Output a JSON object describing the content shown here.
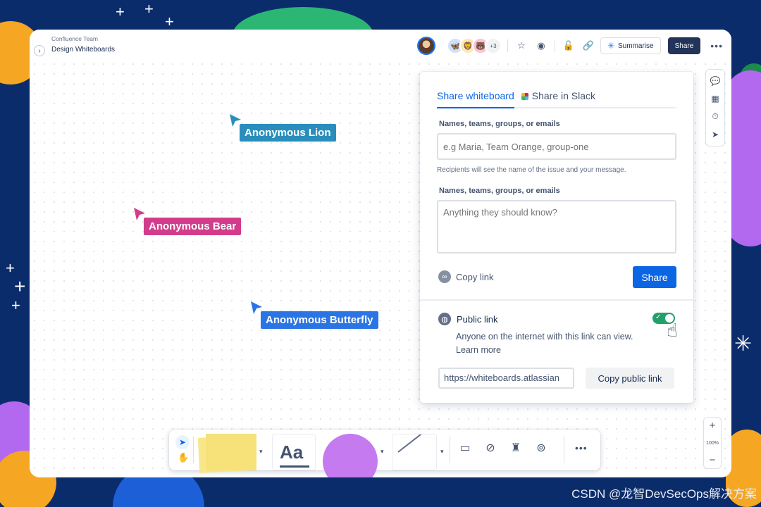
{
  "breadcrumb": {
    "space": "Confluence Team",
    "page": "Design Whiteboards"
  },
  "topbar": {
    "collaborators_more": "+3",
    "summarise_label": "Summarise",
    "share_label": "Share"
  },
  "cursors": {
    "lion": "Anonymous Lion",
    "bear": "Anonymous Bear",
    "butterfly": "Anonymous Butterfly"
  },
  "share_panel": {
    "tab_whiteboard": "Share whiteboard",
    "tab_slack": "Share in Slack",
    "recipients_label": "Names, teams, groups, or emails",
    "recipients_placeholder": "e.g Maria, Team Orange, group-one",
    "recipients_helper": "Recipients will see the name of the issue and your message.",
    "message_label": "Names, teams, groups, or emails",
    "message_placeholder": "Anything they should know?",
    "copy_link_label": "Copy link",
    "share_button": "Share",
    "public_link_title": "Public link",
    "public_link_desc": "Anyone on the internet with this link can view. Learn more",
    "public_link_enabled": true,
    "public_url": "https://whiteboards.atlassian",
    "copy_public_label": "Copy public link"
  },
  "zoom": {
    "level": "100%"
  },
  "toolbar": {
    "text_tool_label": "Aa"
  },
  "colors": {
    "primary": "#0c66e4",
    "lion_cursor": "#2a8ebc",
    "bear_cursor": "#d23d8b",
    "butterfly_cursor": "#2b74e4",
    "toggle_on": "#22a06b"
  },
  "watermark": "CSDN @龙智DevSecOps解决方案"
}
